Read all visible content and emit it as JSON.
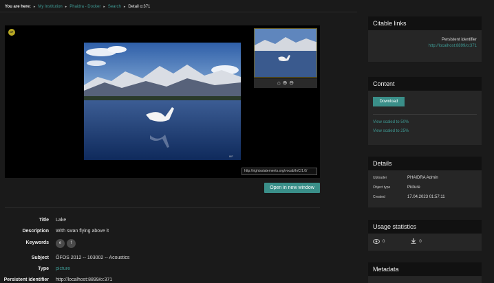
{
  "breadcrumb": {
    "lead": "You are here:",
    "items": [
      "My Institution",
      "Phaidra - Docker",
      "Search"
    ],
    "current": "Detail o:371"
  },
  "viewer": {
    "badge": "IIP",
    "rights_url": "http://rightsstatements.org/vocab/InC/1.0/",
    "watermark": "IIIF"
  },
  "open_button": "Open in new window",
  "metadata": {
    "title_label": "Title",
    "title": "Lake",
    "description_label": "Description",
    "description": "With swan flying above it",
    "keywords_label": "Keywords",
    "keywords": [
      "e",
      "f"
    ],
    "subject_label": "Subject",
    "subject": "ÖFOS 2012 -- 103002 -- Acoustics",
    "type_label": "Type",
    "type": "picture",
    "pid_label": "Persistent identifier",
    "pid": "http://localhost:8899/o:371"
  },
  "citable": {
    "heading": "Citable links",
    "pid_label": "Persistent identifier",
    "pid_url": "http://localhost:8899/o:371"
  },
  "content": {
    "heading": "Content",
    "download": "Download",
    "links": [
      "View scaled to 50%",
      "View scaled to 25%"
    ]
  },
  "details": {
    "heading": "Details",
    "uploader_label": "Uploader",
    "uploader": "PHAIDRA Admin",
    "objtype_label": "Object type",
    "objtype": "Picture",
    "created_label": "Created",
    "created": "17.04.2023 01:57:11"
  },
  "usage": {
    "heading": "Usage statistics",
    "views": "0",
    "downloads": "0"
  },
  "metadata_panel": {
    "heading": "Metadata"
  },
  "colors": {
    "accent": "#3a8f89",
    "link": "#3e9a94",
    "background": "#1a1a1a"
  }
}
